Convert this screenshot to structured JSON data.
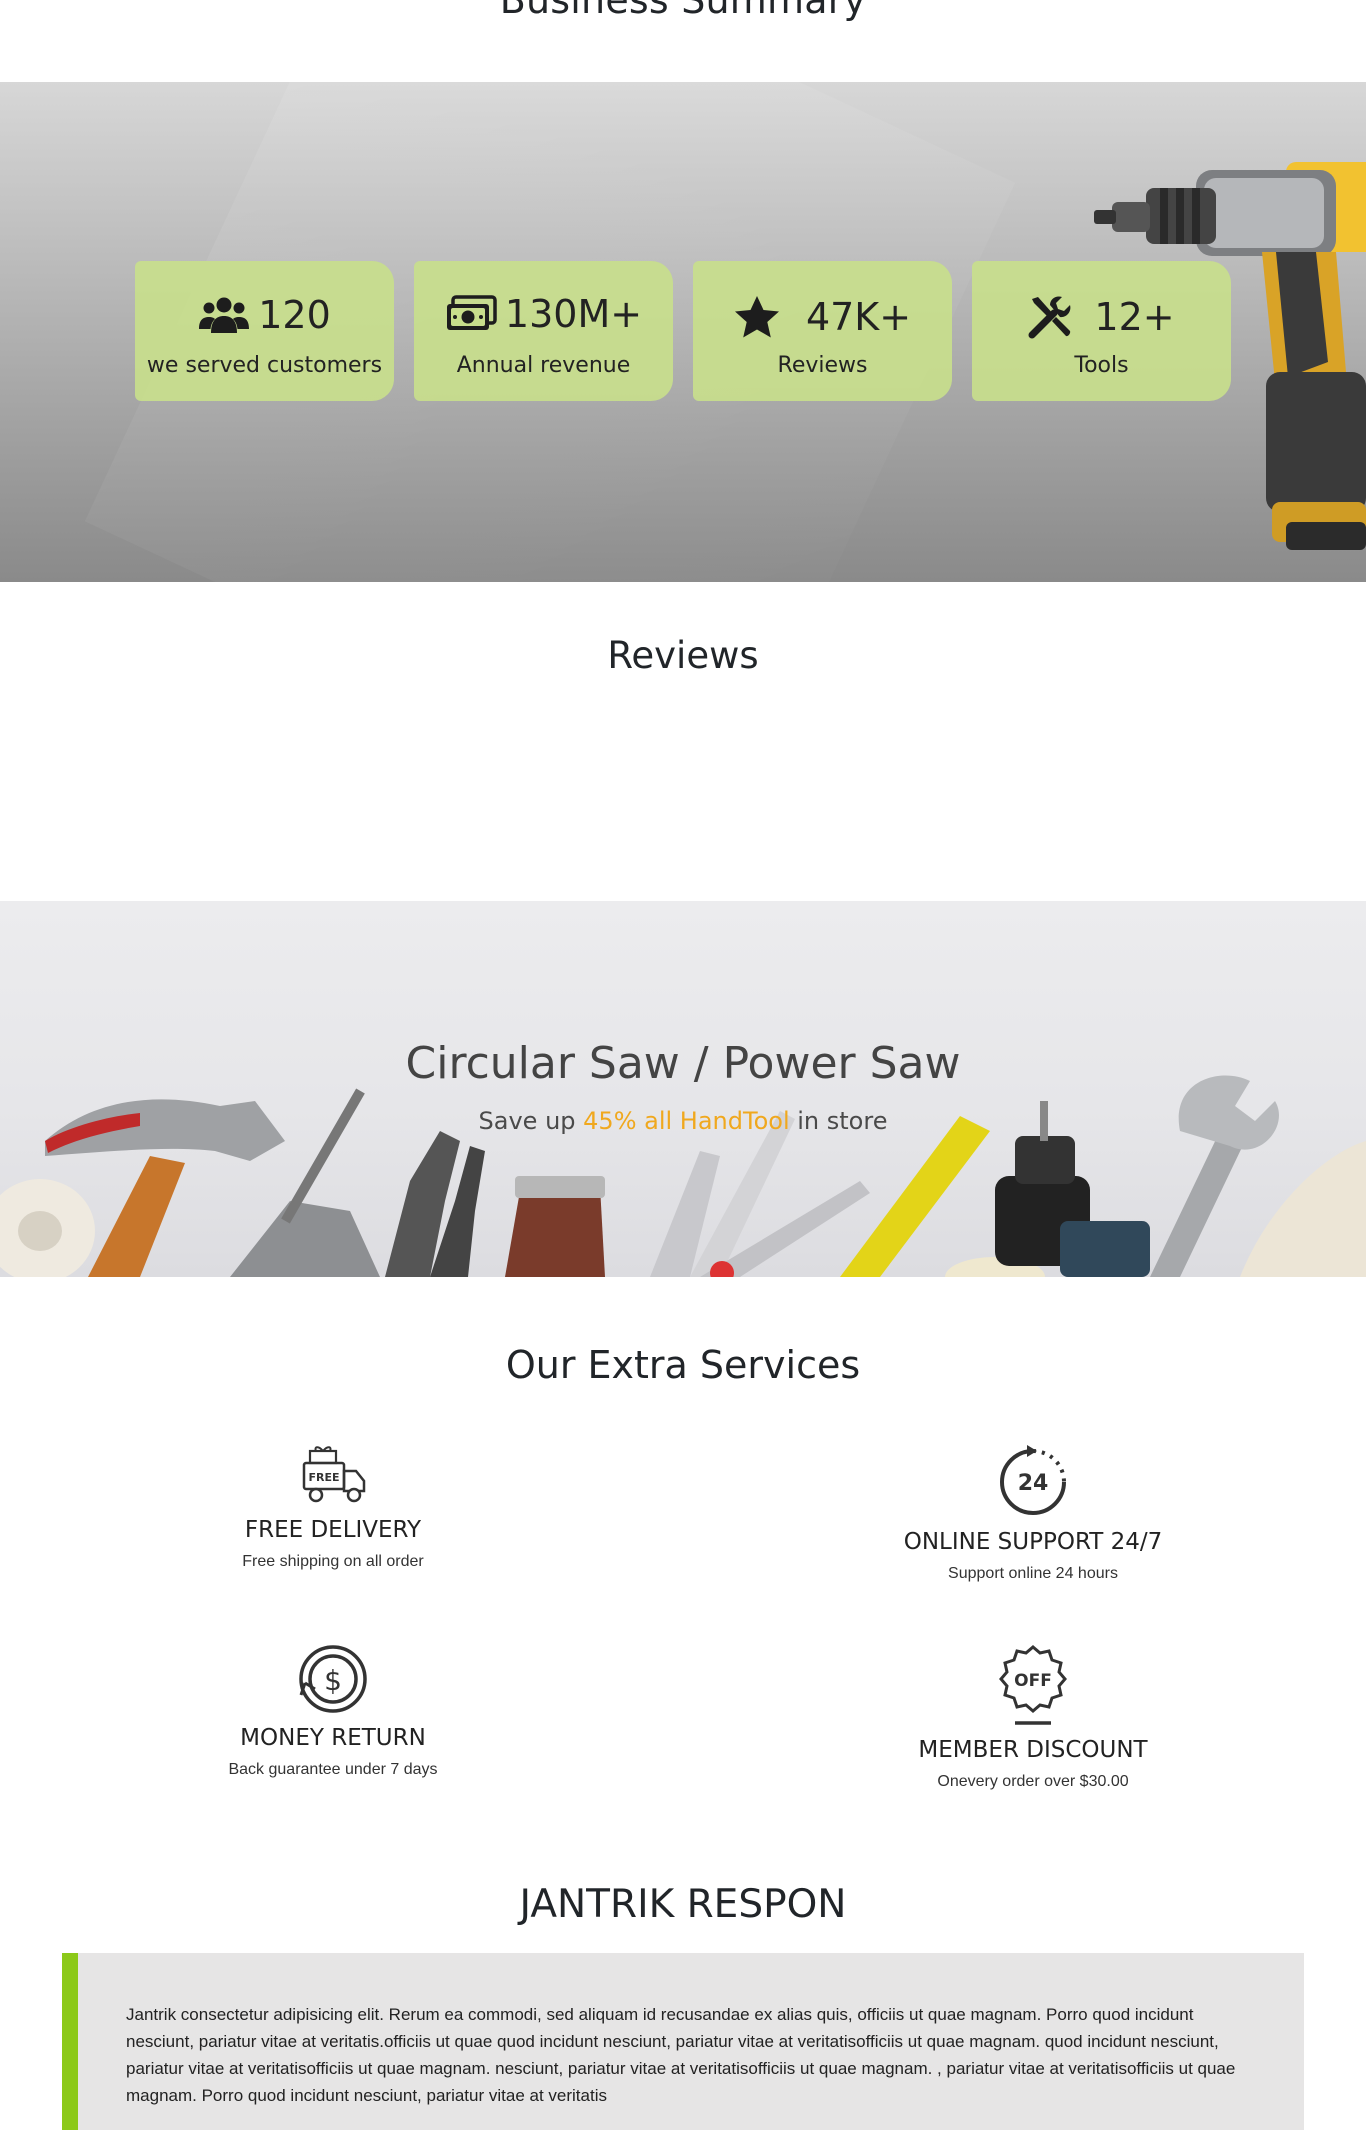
{
  "business_summary": {
    "title": "Business Summary",
    "stats": [
      {
        "icon": "users-icon",
        "value": "120",
        "label": "we served customers"
      },
      {
        "icon": "money-icon",
        "value": "130M+",
        "label": "Annual revenue"
      },
      {
        "icon": "star-icon",
        "value": "47K+",
        "label": "Reviews"
      },
      {
        "icon": "tools-icon",
        "value": "12+",
        "label": "Tools"
      }
    ],
    "card_color": "#c8de8c"
  },
  "reviews": {
    "title": "Reviews"
  },
  "promo": {
    "title": "Circular Saw / Power Saw",
    "subtitle_before": "Save up ",
    "subtitle_highlight": "45% all HandTool",
    "subtitle_after": " in store",
    "highlight_color": "#f0a81e"
  },
  "extra_services": {
    "title": "Our Extra Services",
    "items": [
      {
        "icon": "free-delivery-truck-icon",
        "title": "FREE DELIVERY",
        "desc": "Free shipping on all order"
      },
      {
        "icon": "support-24-icon",
        "title": "ONLINE SUPPORT 24/7",
        "desc": "Support online 24 hours"
      },
      {
        "icon": "money-return-icon",
        "title": "MONEY RETURN",
        "desc": "Back guarantee under 7 days"
      },
      {
        "icon": "discount-off-icon",
        "title": "MEMBER DISCOUNT",
        "desc": "Onevery order over $30.00"
      }
    ]
  },
  "jantrik": {
    "title": "JANTRIK RESPON",
    "text": "Jantrik consectetur adipisicing elit. Rerum ea commodi, sed aliquam id recusandae ex alias quis, officiis ut quae magnam. Porro quod incidunt nesciunt, pariatur vitae at veritatis.officiis ut quae quod incidunt nesciunt, pariatur vitae at veritatisofficiis ut quae magnam. quod incidunt nesciunt, pariatur vitae at veritatisofficiis ut quae magnam. nesciunt, pariatur vitae at veritatisofficiis ut quae magnam. , pariatur vitae at veritatisofficiis ut quae magnam. Porro quod incidunt nesciunt, pariatur vitae at veritatis",
    "accent_color": "#8cc919"
  }
}
